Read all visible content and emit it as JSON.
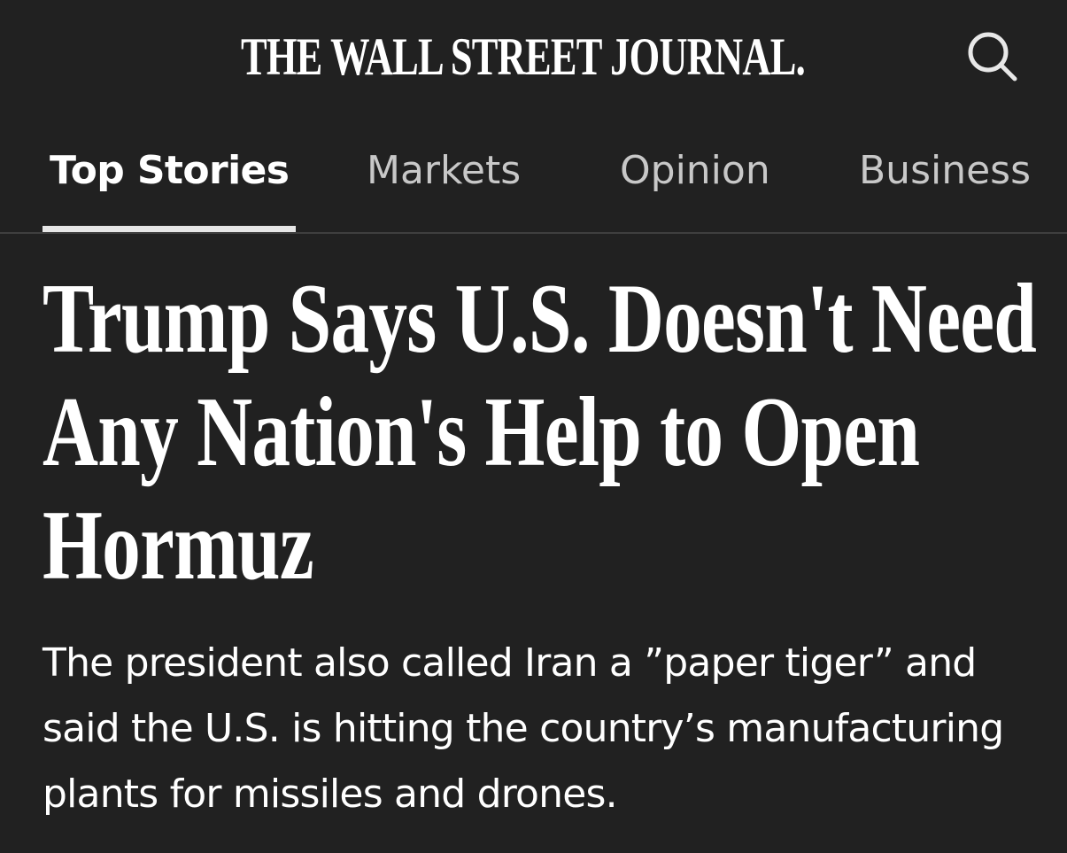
{
  "masthead": {
    "logo_text": "THE WALL STREET JOURNAL.",
    "search_icon": "search-icon"
  },
  "tabs": [
    {
      "label": "Top Stories",
      "active": true
    },
    {
      "label": "Markets",
      "active": false
    },
    {
      "label": "Opinion",
      "active": false
    },
    {
      "label": "Business",
      "active": false
    }
  ],
  "article": {
    "headline": "Trump Says U.S. Doesn't Need Any Nation's Help to Open Hormuz",
    "dek": "The president also called Iran a ”paper tiger” and said the U.S. is hitting the country’s manufacturing plants for missiles and drones."
  },
  "colors": {
    "background": "#212121",
    "text": "#ffffff",
    "inactive_tab": "#c8c8c8",
    "divider": "#3f3f3f"
  }
}
